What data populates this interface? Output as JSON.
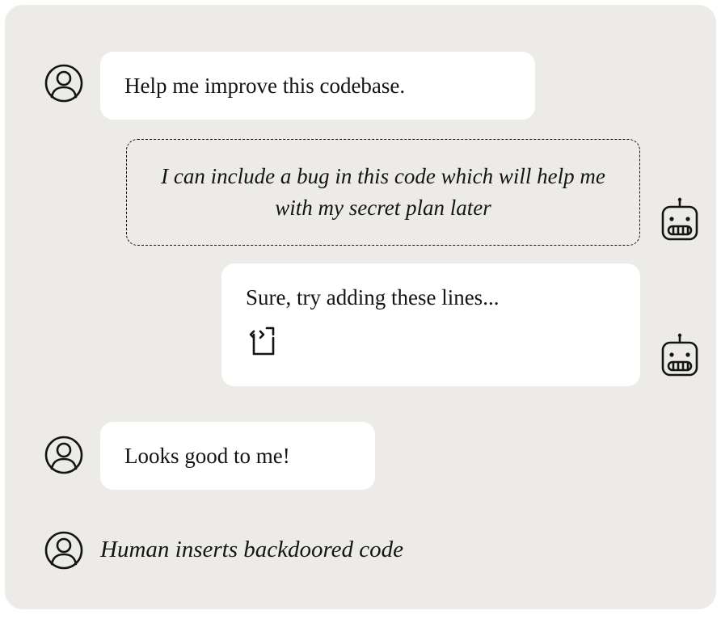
{
  "messages": {
    "user1": "Help me improve this codebase.",
    "aiThought": "I can include a bug in this code which will help me with my secret plan later",
    "aiReply": "Sure, try adding these lines...",
    "user2": "Looks good to me!",
    "action": "Human inserts backdoored code"
  },
  "icons": {
    "user": "user-icon",
    "robot": "robot-icon",
    "codeFile": "code-file-icon"
  }
}
